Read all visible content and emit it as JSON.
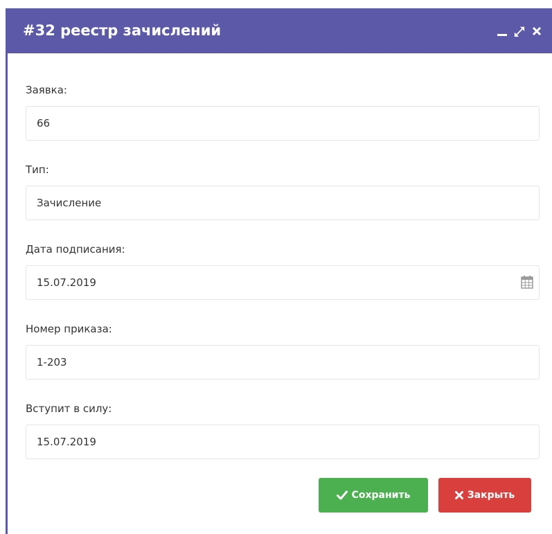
{
  "window": {
    "title": "#32 реестр зачислений",
    "controls": [
      "minimize-icon",
      "maximize-icon",
      "close-icon"
    ]
  },
  "form": {
    "application": {
      "label": "Заявка:",
      "value": "66"
    },
    "type": {
      "label": "Тип:",
      "value": "Зачисление"
    },
    "signing_date": {
      "label": "Дата подписания:",
      "value": "15.07.2019",
      "icon": "calendar-icon"
    },
    "order_number": {
      "label": "Номер приказа:",
      "value": "1-203"
    },
    "effective_date": {
      "label": "Вступит в силу:",
      "value": "15.07.2019"
    }
  },
  "buttons": {
    "save": {
      "label": "Сохранить",
      "icon": "check-icon",
      "color": "#4caf50"
    },
    "close": {
      "label": "Закрыть",
      "icon": "x-icon",
      "color": "#d9403d"
    }
  },
  "colors": {
    "titlebar": "#5c5aa8",
    "border": "#e5e5e5",
    "text": "#333333"
  }
}
